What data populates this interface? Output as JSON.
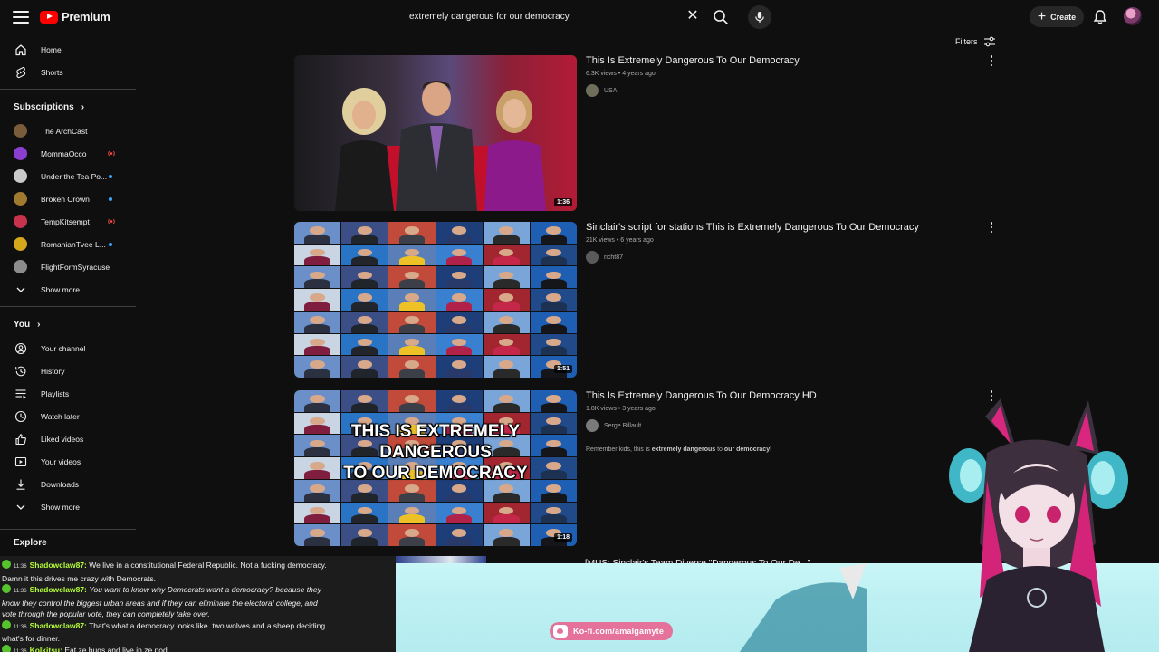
{
  "app": {
    "logo_text": "Premium"
  },
  "search": {
    "query": "extremely dangerous for our democracy"
  },
  "header": {
    "create_label": "Create"
  },
  "sidebar": {
    "main": [
      {
        "label": "Home",
        "icon": "home-icon"
      },
      {
        "label": "Shorts",
        "icon": "shorts-icon"
      }
    ],
    "subscriptions_heading": "Subscriptions",
    "subscriptions": [
      {
        "label": "The ArchCast",
        "indicator": "none",
        "color": "#7a5b3a"
      },
      {
        "label": "MommaOcco",
        "indicator": "live",
        "color": "#8a3fd1"
      },
      {
        "label": "Under the Tea Po...",
        "indicator": "new",
        "color": "#c9c9c9"
      },
      {
        "label": "Broken Crown",
        "indicator": "new",
        "color": "#a07a2e"
      },
      {
        "label": "TempKitsempt",
        "indicator": "live",
        "color": "#c7334d"
      },
      {
        "label": "RomanianTvee L...",
        "indicator": "new",
        "color": "#d4a81b"
      },
      {
        "label": "FlightFormSyracuse",
        "indicator": "none",
        "color": "#8c8c8c"
      }
    ],
    "subscriptions_more": "Show more",
    "you_heading": "You",
    "you": [
      {
        "label": "Your channel",
        "icon": "channel-icon"
      },
      {
        "label": "History",
        "icon": "history-icon"
      },
      {
        "label": "Playlists",
        "icon": "playlists-icon"
      },
      {
        "label": "Watch later",
        "icon": "watch-later-icon"
      },
      {
        "label": "Liked videos",
        "icon": "like-icon"
      },
      {
        "label": "Your videos",
        "icon": "your-videos-icon"
      },
      {
        "label": "Downloads",
        "icon": "download-icon"
      }
    ],
    "you_more": "Show more",
    "explore_heading": "Explore"
  },
  "filters": {
    "label": "Filters"
  },
  "results": [
    {
      "title": "This Is Extremely Dangerous To Our Democracy",
      "views": "6.3K views",
      "age": "4 years ago",
      "channel": "USA",
      "duration": "1:36",
      "description": ""
    },
    {
      "title": "Sinclair's script for stations This is Extremely Dangerous To Our Democracy",
      "views": "21K views",
      "age": "6 years ago",
      "channel": "richt87",
      "duration": "1:51",
      "description": ""
    },
    {
      "title": "This Is Extremely Dangerous To Our Democracy HD",
      "views": "1.8K views",
      "age": "3 years ago",
      "channel": "Serge Billault",
      "duration": "1:18",
      "description_pre": "Remember kids, this is ",
      "description_bold": "extremely dangerous",
      "description_mid": " to ",
      "description_bold2": "our democracy",
      "description_post": "!",
      "overlay_line1": "THIS IS EXTREMELY DANGEROUS",
      "overlay_line2": "TO OUR DEMOCRACY"
    }
  ],
  "peek_title": "[MUS: Sinclair's Team Diverse \"Dangerous To Our De...\"",
  "chat": [
    {
      "time": "11:36",
      "user": "Shadowclaw87:",
      "text": "We live in a constitutional Federal Republic. Not a fucking democracy.",
      "italic": false
    },
    {
      "time": "",
      "user": "",
      "text": "Damn it this drives me crazy with Democrats.",
      "italic": false
    },
    {
      "time": "11:36",
      "user": "Shadowclaw87:",
      "text": "You want to know why Democrats want a democracy? because they",
      "italic": true
    },
    {
      "time": "",
      "user": "",
      "text": "know they control the biggest urban areas and if they can eliminate the electoral college, and",
      "italic": true
    },
    {
      "time": "",
      "user": "",
      "text": "vote through the popular vote, they can completely take over.",
      "italic": true
    },
    {
      "time": "11:36",
      "user": "Shadowclaw87:",
      "text": "That's what a democracy looks like. two wolves and a sheep deciding",
      "italic": false
    },
    {
      "time": "",
      "user": "",
      "text": "what's for dinner.",
      "italic": false
    },
    {
      "time": "11:36",
      "user": "Kolkitsu:",
      "text": "Eat ze bugs and live in ze pod",
      "italic": false
    }
  ],
  "stream": {
    "kofi_label": "Ko-fi.com/amalgamyte"
  },
  "colors": {
    "background": "#0f0f0f",
    "brand_red": "#ff0000",
    "chat_user": "#b6ff3a",
    "kofi_pink": "#e4729a",
    "stream_bg": "#c9f6f7"
  }
}
